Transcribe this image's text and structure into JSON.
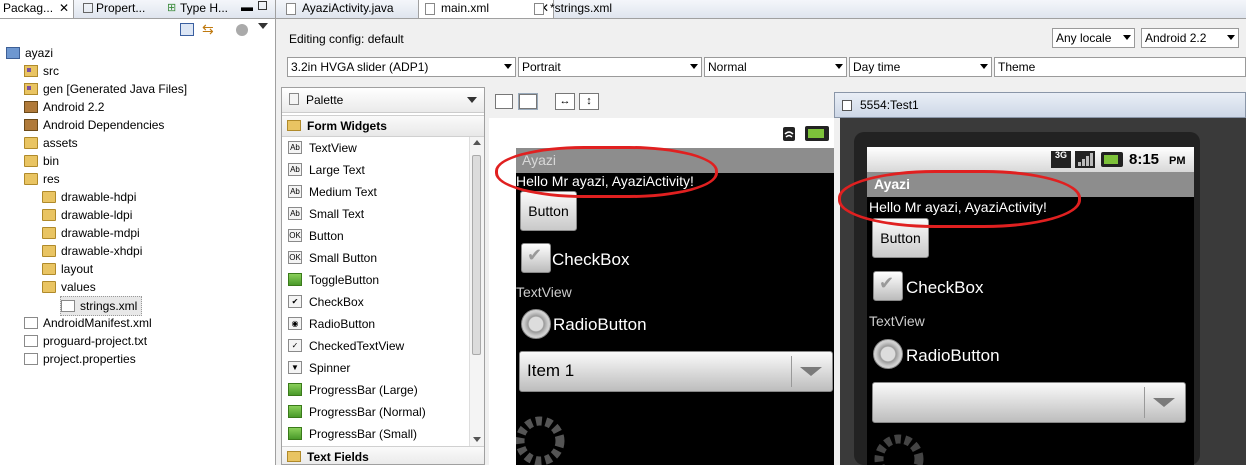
{
  "left_panel": {
    "tabs": [
      "Packag...",
      "Propert...",
      "Type H..."
    ],
    "tree": [
      {
        "label": "ayazi",
        "icon": "project-icon",
        "indent": 0
      },
      {
        "label": "src",
        "icon": "source-folder-icon",
        "indent": 1
      },
      {
        "label": "gen [Generated Java Files]",
        "icon": "source-folder-icon",
        "indent": 1
      },
      {
        "label": "Android 2.2",
        "icon": "library-icon",
        "indent": 1
      },
      {
        "label": "Android Dependencies",
        "icon": "library-icon",
        "indent": 1
      },
      {
        "label": "assets",
        "icon": "folder-icon",
        "indent": 1
      },
      {
        "label": "bin",
        "icon": "folder-icon",
        "indent": 1
      },
      {
        "label": "res",
        "icon": "folder-icon",
        "indent": 1
      },
      {
        "label": "drawable-hdpi",
        "icon": "folder-icon",
        "indent": 2
      },
      {
        "label": "drawable-ldpi",
        "icon": "folder-icon",
        "indent": 2
      },
      {
        "label": "drawable-mdpi",
        "icon": "folder-icon",
        "indent": 2
      },
      {
        "label": "drawable-xhdpi",
        "icon": "folder-icon",
        "indent": 2
      },
      {
        "label": "layout",
        "icon": "folder-icon",
        "indent": 2
      },
      {
        "label": "values",
        "icon": "folder-icon",
        "indent": 2
      },
      {
        "label": "strings.xml",
        "icon": "xml-file-icon",
        "indent": 3
      },
      {
        "label": "AndroidManifest.xml",
        "icon": "xml-file-icon",
        "indent": 1
      },
      {
        "label": "proguard-project.txt",
        "icon": "text-file-icon",
        "indent": 1
      },
      {
        "label": "project.properties",
        "icon": "text-file-icon",
        "indent": 1
      }
    ]
  },
  "editor_tabs": [
    {
      "label": "AyaziActivity.java"
    },
    {
      "label": "main.xml"
    },
    {
      "label": "*strings.xml"
    }
  ],
  "config": {
    "editing_config": "Editing config:  default",
    "locale": "Any locale",
    "api": "Android 2.2",
    "device": "3.2in HVGA slider (ADP1)",
    "orientation": "Portrait",
    "dock": "Normal",
    "night": "Day time",
    "theme": "Theme"
  },
  "palette": {
    "header": "Palette",
    "category": "Form Widgets",
    "items": [
      {
        "label": "TextView",
        "icon": "Ab"
      },
      {
        "label": "Large Text",
        "icon": "Ab"
      },
      {
        "label": "Medium Text",
        "icon": "Ab"
      },
      {
        "label": "Small Text",
        "icon": "Ab"
      },
      {
        "label": "Button",
        "icon": "OK"
      },
      {
        "label": "Small Button",
        "icon": "OK"
      },
      {
        "label": "ToggleButton",
        "icon": ""
      },
      {
        "label": "CheckBox",
        "icon": "✔"
      },
      {
        "label": "RadioButton",
        "icon": "◉"
      },
      {
        "label": "CheckedTextView",
        "icon": "✓"
      },
      {
        "label": "Spinner",
        "icon": "▼"
      },
      {
        "label": "ProgressBar (Large)",
        "icon": ""
      },
      {
        "label": "ProgressBar (Normal)",
        "icon": ""
      },
      {
        "label": "ProgressBar (Small)",
        "icon": ""
      }
    ],
    "next_category": "Text Fields"
  },
  "layout_preview": {
    "app_title": "Ayazi",
    "hello": "Hello Mr ayazi, AyaziActivity!",
    "button": "Button",
    "checkbox": "CheckBox",
    "textview": "TextView",
    "radio": "RadioButton",
    "spinner_item": "Item 1"
  },
  "emulator": {
    "window_title": "5554:Test1",
    "time": "8:15",
    "ampm": "PM",
    "network": "3G",
    "app_title": "Ayazi",
    "hello": "Hello Mr ayazi, AyaziActivity!",
    "button": "Button",
    "checkbox": "CheckBox",
    "textview": "TextView",
    "radio": "RadioButton"
  },
  "colors": {
    "annotation": "#e02020",
    "android_bg": "#000000",
    "title_bar": "#8a8a8a"
  }
}
